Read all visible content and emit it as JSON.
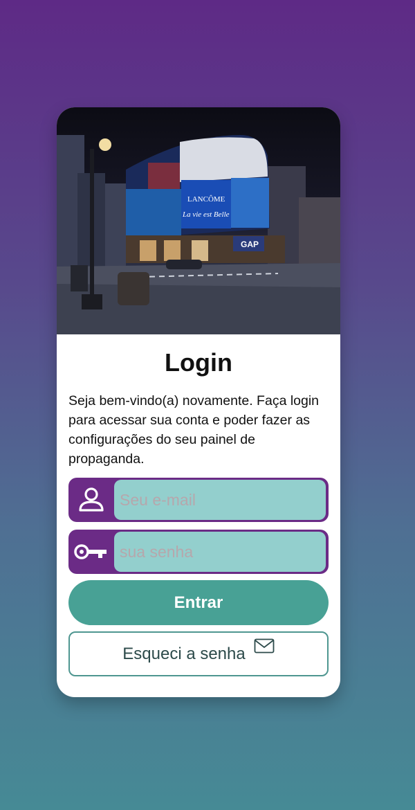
{
  "login": {
    "title": "Login",
    "description": "Seja bem-vindo(a) novamente. Faça login para acessar sua conta e poder fazer as configurações do seu painel de propaganda.",
    "email_placeholder": "Seu e-mail",
    "password_placeholder": "sua senha",
    "submit_label": "Entrar",
    "forgot_label": "Esqueci a senha"
  },
  "hero": {
    "billboard_brand": "LANCÔME",
    "billboard_tagline": "La vie est Belle",
    "store_sign": "GAP"
  },
  "icons": {
    "email_field_icon": "user-icon",
    "password_field_icon": "key-icon",
    "forgot_button_icon": "mail-icon"
  },
  "colors": {
    "field_accent": "#6b2b86",
    "input_fill": "#93cfcd",
    "primary_button": "#48a195",
    "secondary_border": "#4e9690"
  }
}
